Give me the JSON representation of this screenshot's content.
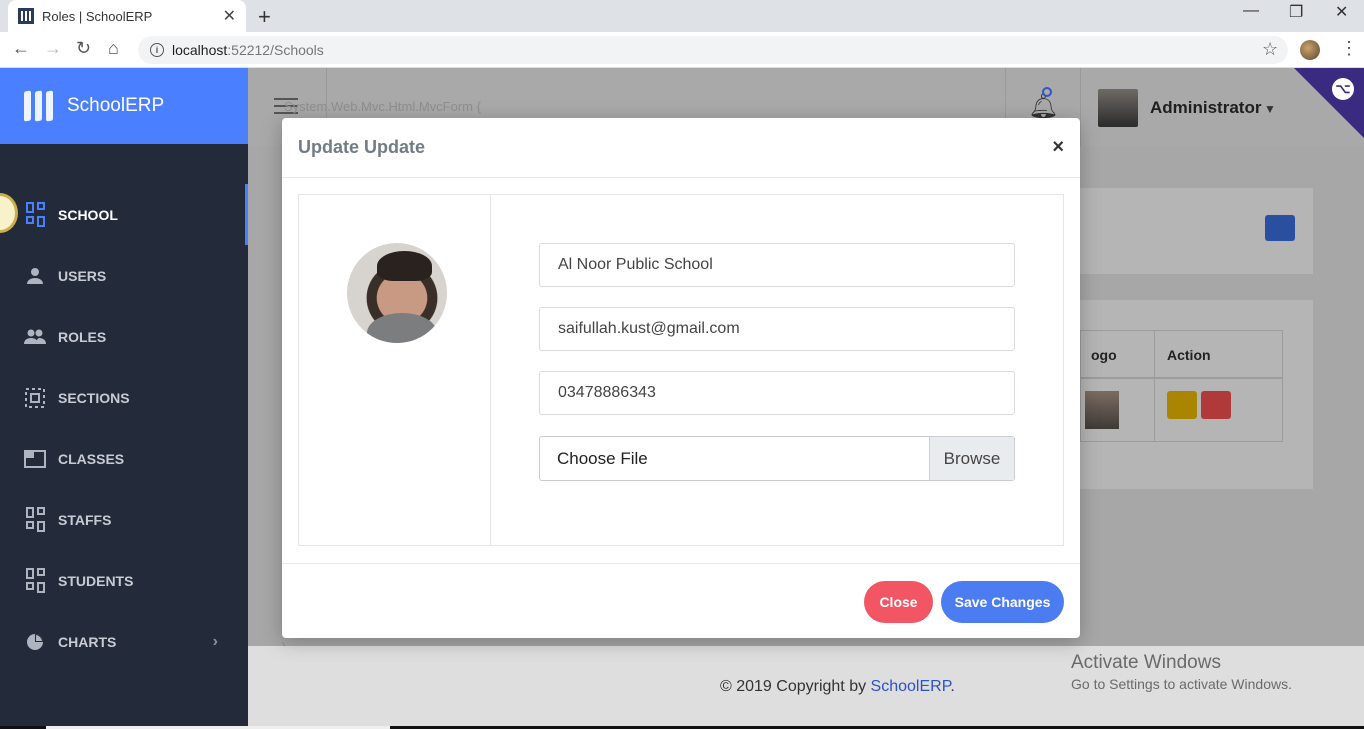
{
  "browser": {
    "tab_title": "Roles | SchoolERP",
    "tab_close": "✕",
    "new_tab": "+",
    "url_host": "localhost",
    "url_rest": ":52212/Schools"
  },
  "sidebar": {
    "brand": "SchoolERP",
    "items": [
      {
        "label": "SCHOOL",
        "icon": "dashboard-grid-icon",
        "active": true
      },
      {
        "label": "USERS",
        "icon": "user-icon"
      },
      {
        "label": "ROLES",
        "icon": "group-icon"
      },
      {
        "label": "SECTIONS",
        "icon": "selection-icon"
      },
      {
        "label": "CLASSES",
        "icon": "window-icon"
      },
      {
        "label": "STAFFS",
        "icon": "dashboard-grid-icon"
      },
      {
        "label": "STUDENTS",
        "icon": "dashboard-grid-icon"
      },
      {
        "label": "CHARTS",
        "icon": "pie-chart-icon",
        "has_submenu": true
      }
    ]
  },
  "topbar": {
    "form_text": "System.Web.Mvc.Html.MvcForm {",
    "user_name": "Administrator"
  },
  "table": {
    "col_logo": "ogo",
    "col_action": "Action"
  },
  "stray_text": ")",
  "modal": {
    "title": "Update Update",
    "close_glyph": "×",
    "name_value": "Al Noor Public School",
    "email_value": "saifullah.kust@gmail.com",
    "phone_value": "03478886343",
    "file_label": "Choose File",
    "browse_label": "Browse",
    "close_button": "Close",
    "save_button": "Save Changes"
  },
  "footer": {
    "copyright_prefix": "© 2019 Copyright by ",
    "copyright_brand": "SchoolERP",
    "copyright_suffix": "."
  },
  "watermark": {
    "line1": "Activate Windows",
    "line2": "Go to Settings to activate Windows."
  },
  "colors": {
    "brand_blue": "#4a80ff",
    "sidebar_bg": "#232b3a",
    "close_red": "#f25664",
    "save_blue": "#4b7cf2"
  }
}
